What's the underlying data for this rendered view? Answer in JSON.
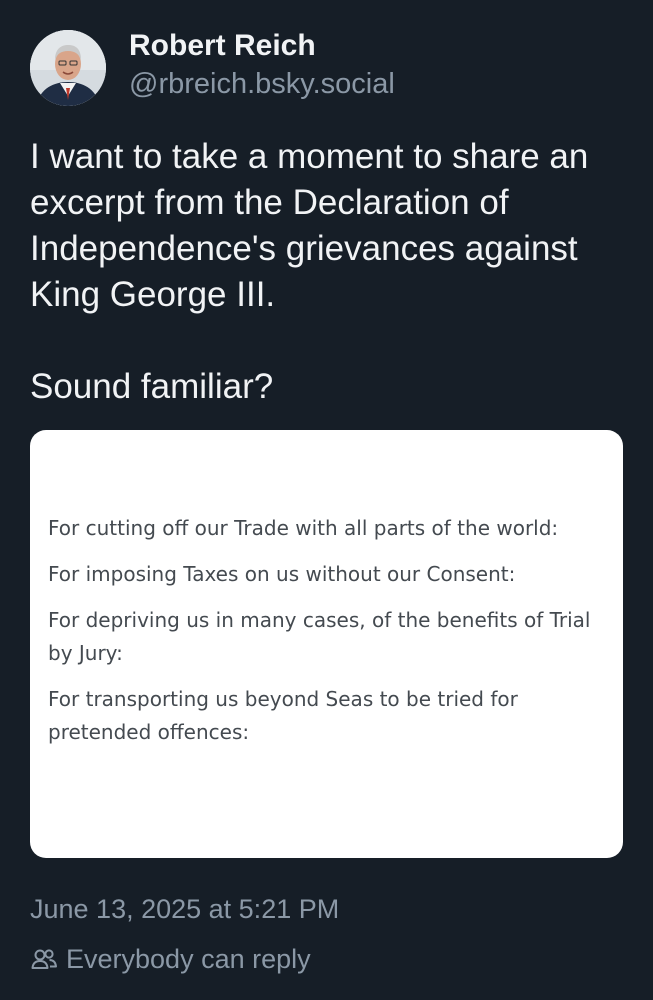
{
  "author": {
    "display_name": "Robert Reich",
    "handle": "@rbreich.bsky.social",
    "avatar_icon": "avatar-photo"
  },
  "post": {
    "paragraphs": [
      "I want to take a moment to share an excerpt from the Declaration of Independence's grievances against King George III.",
      "Sound familiar?"
    ]
  },
  "image": {
    "lines": [
      "For cutting off our Trade with all parts of the world:",
      "For imposing Taxes on us without our Consent:",
      "For depriving us in many cases, of the benefits of Trial by Jury:",
      "For transporting us beyond Seas to be tried for pretended offences:"
    ]
  },
  "meta": {
    "timestamp": "June 13, 2025 at 5:21 PM",
    "reply_setting": "Everybody can reply",
    "reply_icon": "people-icon"
  },
  "colors": {
    "background": "#161e27",
    "primary_text": "#f1f3f5",
    "secondary_text": "#8b98a6",
    "card_background": "#ffffff",
    "card_text": "#444a50"
  }
}
